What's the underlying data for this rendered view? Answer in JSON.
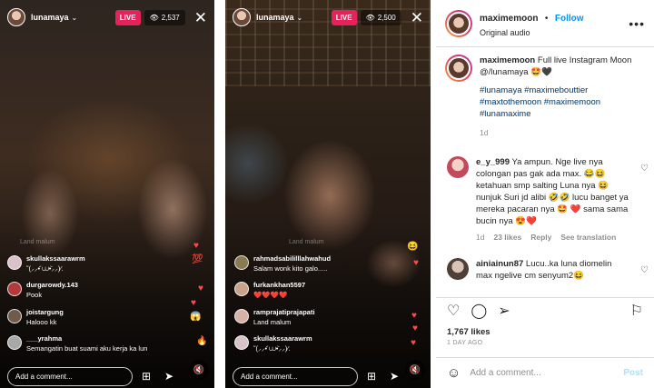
{
  "left_live": {
    "host": "lunamaya",
    "badge": "LIVE",
    "viewers": "2,537",
    "faded_comment": "Land malum",
    "comments": [
      {
        "user": "skullakssaarawrm",
        "text": "˜(⸝⸝•᷄ ‎⩊•᷅⸝⸝)⁄."
      },
      {
        "user": "durgarowdy.143",
        "text": "Pook"
      },
      {
        "user": "joistargung",
        "text": "Halooo kk"
      },
      {
        "user": "___yrahma",
        "text": "Semangatin buat suami aku kerja ka lun"
      }
    ],
    "comment_placeholder": "Add a comment...",
    "icons": [
      "chevron-down-icon",
      "eye-icon",
      "close-icon",
      "mute-icon",
      "add-people-icon",
      "send-icon",
      "heart-icon"
    ]
  },
  "right_live": {
    "host": "lunamaya",
    "badge": "LIVE",
    "viewers": "2,500",
    "faded_comment": "Land malum",
    "comments": [
      {
        "user": "rahmadsabililllahwahud",
        "text": "Salam wonk kito galo....."
      },
      {
        "user": "furkankhan5597",
        "text": "❤️❤️❤️❤️"
      },
      {
        "user": "ramprajatiprajapati",
        "text": "Land malum"
      },
      {
        "user": "skullakssaarawrm",
        "text": "˜(⸝⸝•᷄ ‎⩊•᷅⸝⸝)⁄."
      }
    ],
    "comment_placeholder": "Add a comment..."
  },
  "post": {
    "header": {
      "username": "maximemoon",
      "follow_label": "Follow",
      "audio": "Original audio"
    },
    "caption": {
      "username": "maximemoon",
      "text": "Full live Instagram Moon @/lunamaya 🤩🖤",
      "hashtags": "#lunamaya #maximebouttier #maxtothemoon #maximemoon #lunamaxime",
      "age": "1d"
    },
    "comments": [
      {
        "username": "e_y_999",
        "text": "Ya ampun. Nge live nya colongan pas gak ada max. 😂😆 ketahuan smp salting Luna nya 😆 nunjuk Suri jd alibi 🤣🤣 lucu banget ya mereka pacaran nya 🤩 ❤️ sama sama bucin nya 😍❤️",
        "age": "1d",
        "likes": "23 likes",
        "reply": "Reply",
        "translation": "See translation"
      },
      {
        "username": "ainiainun87",
        "text": "Lucu..ka luna diomelin max ngelive cm senyum2😆"
      }
    ],
    "likes": "1,767 likes",
    "date": "1 DAY AGO",
    "add_comment_placeholder": "Add a comment...",
    "post_label": "Post"
  },
  "colors": {
    "live_badge": "#e5225b",
    "follow_blue": "#0095f6",
    "hashtag": "#00376b"
  }
}
